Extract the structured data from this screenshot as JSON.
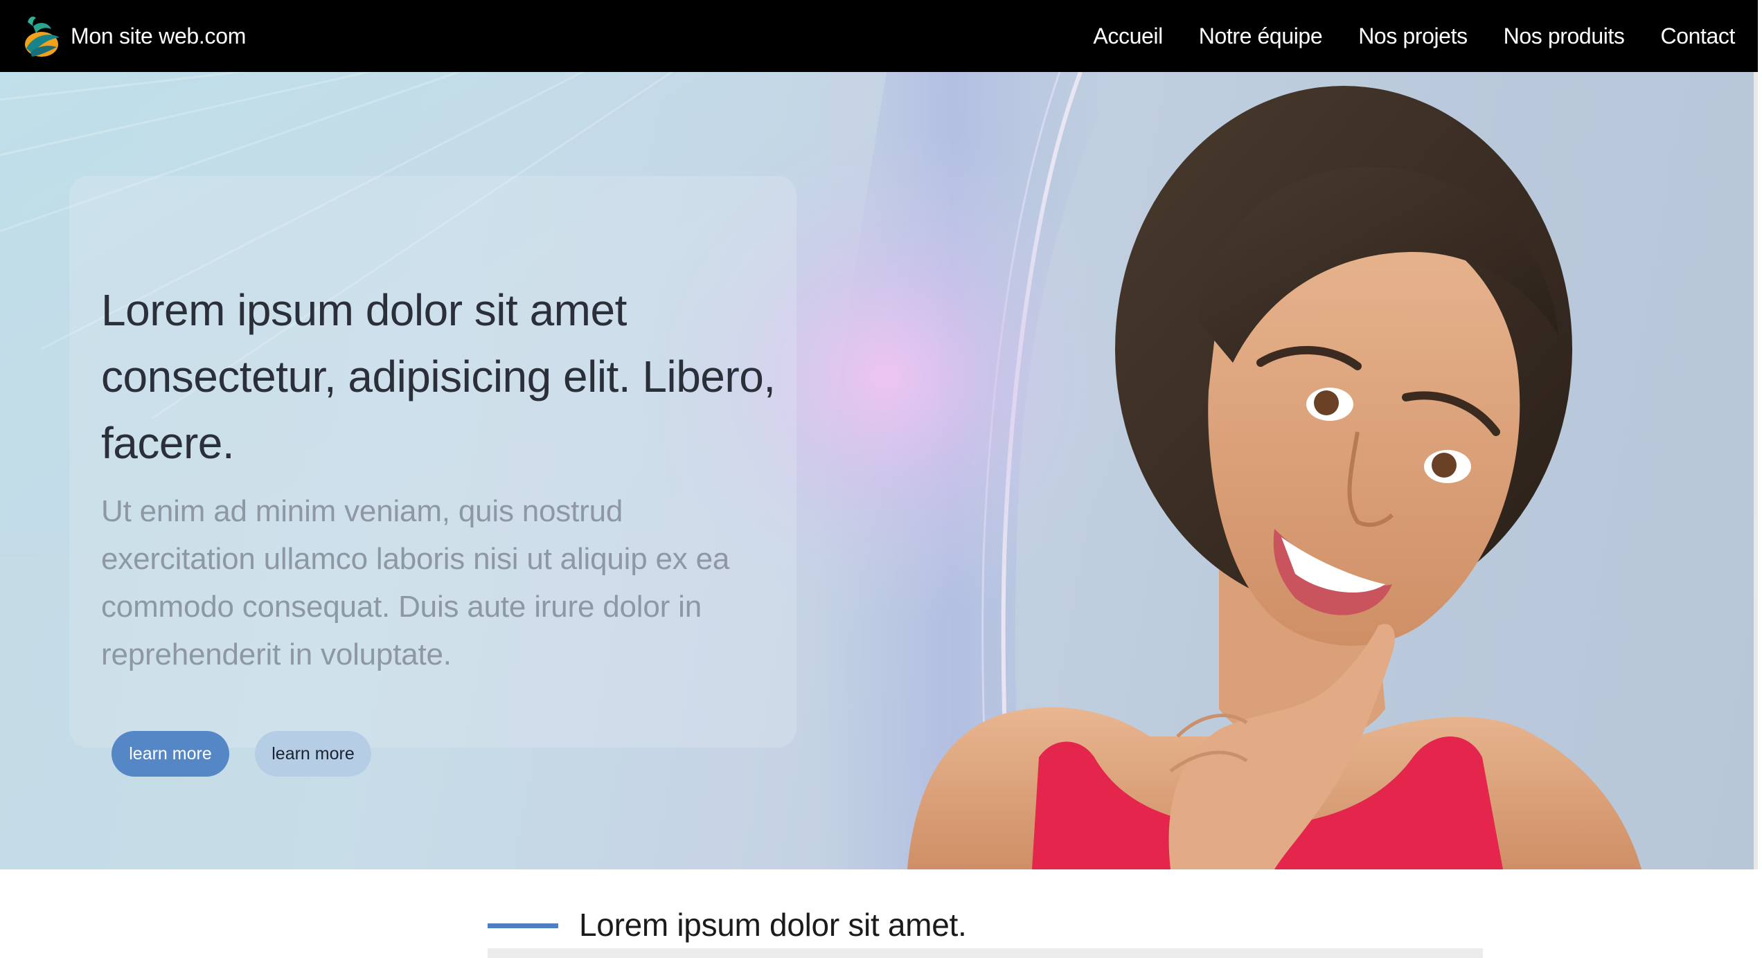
{
  "header": {
    "brand_name": "Mon site web.com",
    "nav": [
      "Accueil",
      "Notre équipe",
      "Nos projets",
      "Nos produits",
      "Contact"
    ]
  },
  "hero": {
    "title": "Lorem ipsum dolor sit amet consectetur, adipisicing elit. Libero, facere.",
    "text": "Ut enim ad minim veniam, quis nostrud exercitation ullamco laboris nisi ut aliquip ex ea commodo consequat. Duis aute irure dolor in reprehenderit in voluptate.",
    "buttons": {
      "primary": "learn more",
      "secondary": "learn more"
    }
  },
  "section": {
    "title": "Lorem ipsum dolor sit amet."
  },
  "colors": {
    "header_bg": "#000000",
    "accent_blue": "#5587c6",
    "secondary_button": "#b6cde6",
    "top_color": "#e8264a"
  }
}
